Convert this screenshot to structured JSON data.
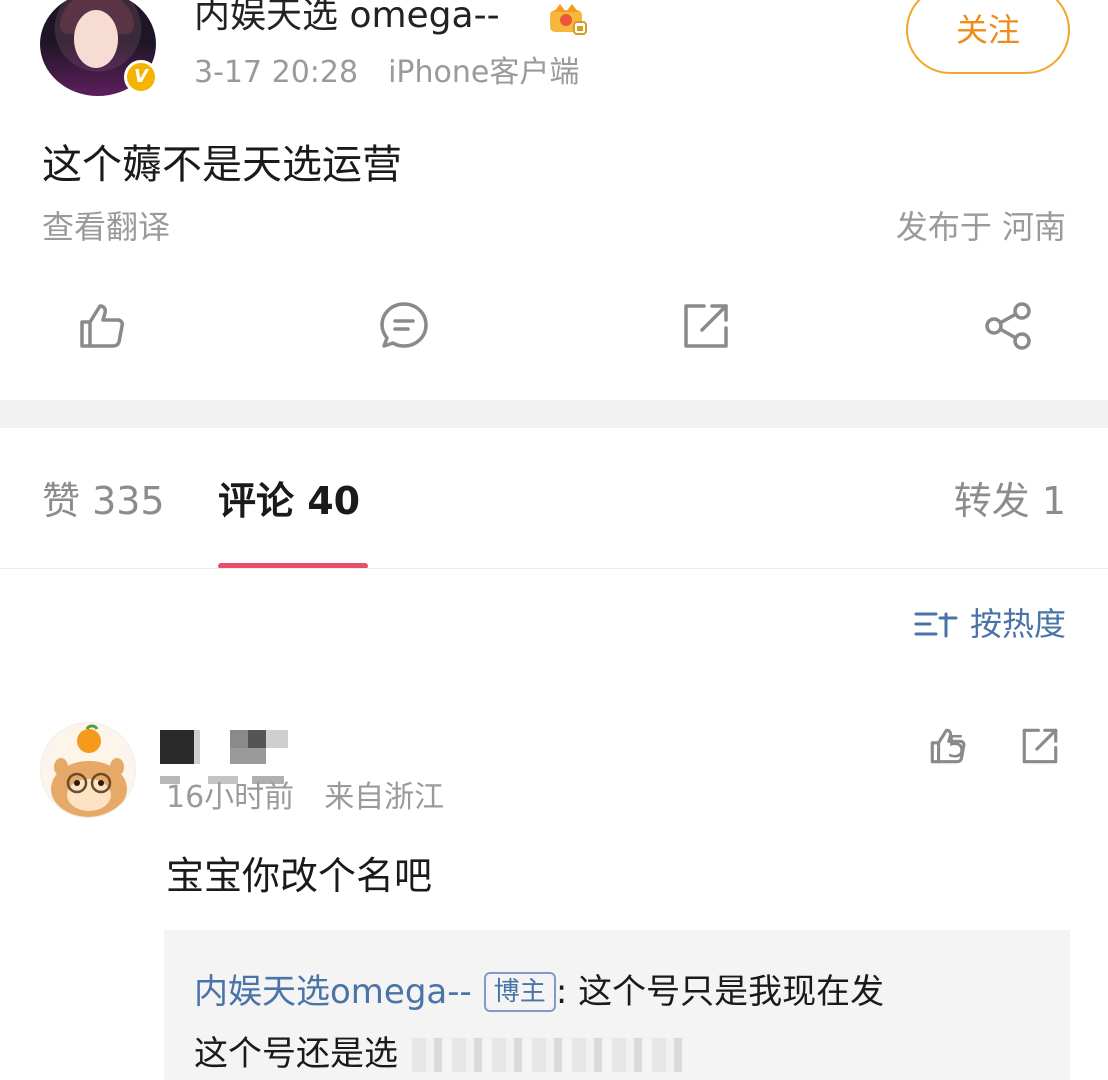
{
  "post": {
    "author": "内娱天选 omega--",
    "time": "3-17 20:28",
    "source": "iPhone客户端",
    "follow_label": "关注",
    "content": "这个薅不是天选运营",
    "translate_label": "查看翻译",
    "location": "发布于 河南",
    "verified_badge": "V"
  },
  "actions": {
    "icons": [
      "thumbs-up-icon",
      "comment-icon",
      "repost-icon",
      "share-icon"
    ]
  },
  "tabs": {
    "likes": "赞 335",
    "comments": "评论 40",
    "reposts": "转发 1"
  },
  "sort": {
    "label": "按热度"
  },
  "comment": {
    "meta_time": "16小时前",
    "meta_location": "来自浙江",
    "like_count": "5",
    "text": "宝宝你改个名吧",
    "reply": {
      "author": "内娱天选omega--",
      "badge": "博主",
      "text_line1": ": 这个号只是我现在发",
      "text_line2": "这个号还是选"
    }
  },
  "colors": {
    "accent_follow": "#f08b17",
    "tab_underline": "#ea4d6c",
    "link_blue": "#4a73a8",
    "verified_yellow": "#f6b400"
  }
}
